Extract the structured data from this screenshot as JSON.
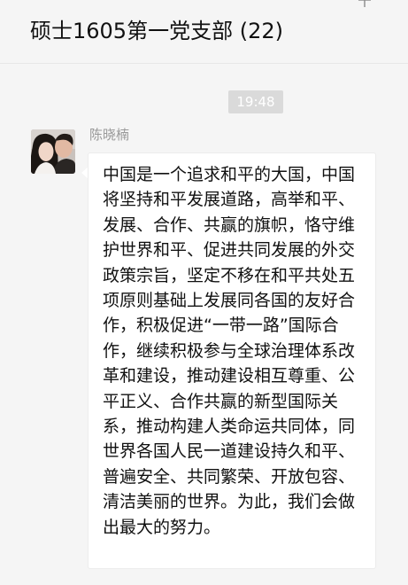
{
  "header": {
    "title": "硕士1605第一党支部 (22)",
    "pin_icon": "pin-icon"
  },
  "chat": {
    "timestamp": "19:48",
    "messages": [
      {
        "sender": "陈晓楠",
        "avatar_icon": "avatar-photo",
        "text": "中国是一个追求和平的大国，中国将坚持和平发展道路，高举和平、发展、合作、共赢的旗帜，恪守维护世界和平、促进共同发展的外交政策宗旨，坚定不移在和平共处五项原则基础上发展同各国的友好合作，积极促进“一带一路”国际合作，继续积极参与全球治理体系改革和建设，推动建设相互尊重、公平正义、合作共赢的新型国际关系，推动构建人类命运共同体，同世界各国人民一道建设持久和平、普遍安全、共同繁荣、开放包容、清洁美丽的世界。为此，我们会做出最大的努力。"
      }
    ]
  },
  "colors": {
    "background": "#f5f5f5",
    "bubble": "#ffffff",
    "timestamp_bg": "#dadada",
    "sender_name": "#999999",
    "text": "#111111"
  }
}
